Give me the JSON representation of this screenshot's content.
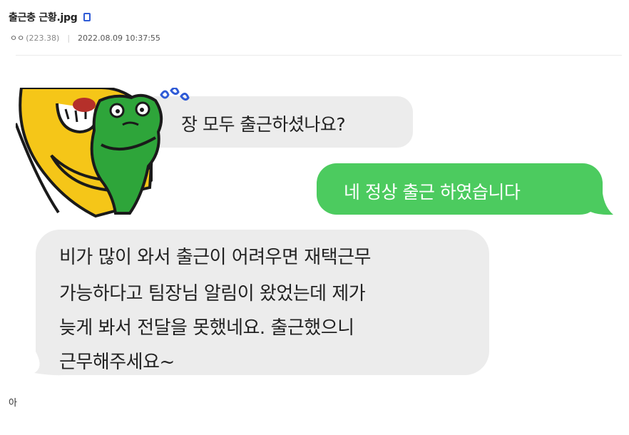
{
  "post": {
    "title": "출근충 근황.jpg",
    "author": "ㅇㅇ",
    "ip": "(223.38)",
    "separator": "|",
    "date": "2022.08.09 10:37:55"
  },
  "chat": {
    "message_1": "장 모두 출근하셨나요?",
    "message_2": "네 정상 출근 하였습니다",
    "message_3_lines": [
      "비가 많이 와서 출근이 어려우면 재택근무",
      "가능하다고 팀장님 알림이 왔었는데 제가",
      "늦게 봐서 전달을 못했네요. 출근했으니",
      "근무해주세요~"
    ]
  },
  "body": {
    "text": "아"
  },
  "colors": {
    "sent_bubble": "#4ccb5f",
    "received_bubble": "#ececec",
    "title_icon": "#2f5bd6",
    "character_yellow": "#f5c618",
    "character_green": "#2ea53a"
  },
  "icons": [
    "image-attachment-icon",
    "sticker-lion-icon",
    "sticker-frog-icon",
    "sweat-drops-icon"
  ]
}
